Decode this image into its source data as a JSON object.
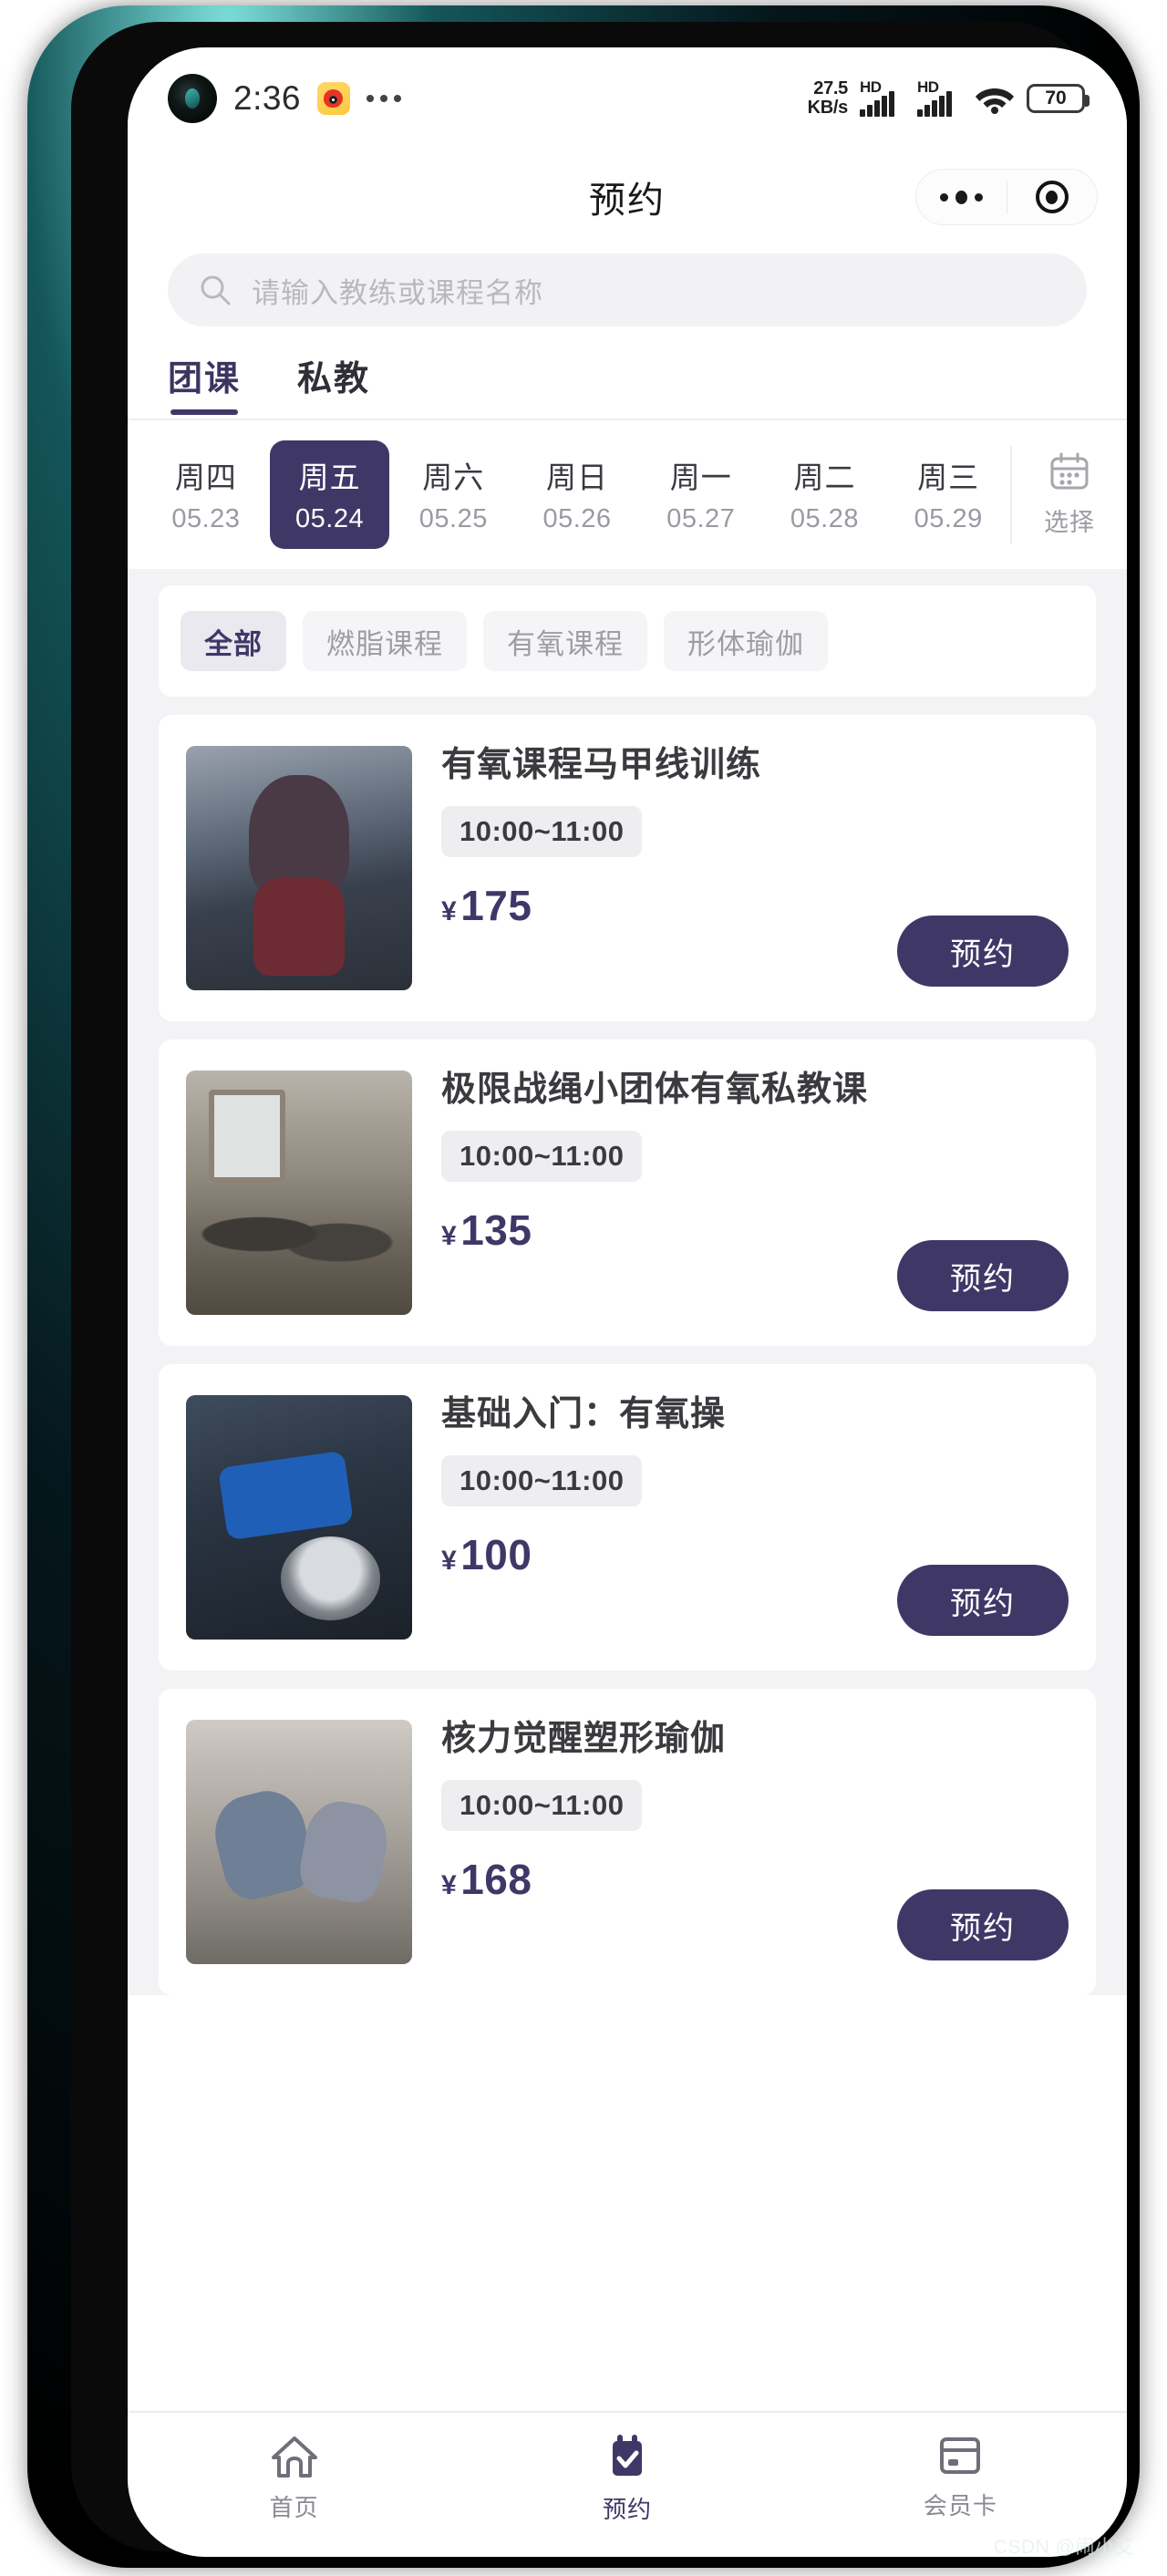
{
  "status_bar": {
    "time": "2:36",
    "notification_icon": "weibo-icon",
    "more_icon": "more-dots-icon",
    "network_speed": "27.5",
    "network_speed_unit": "KB/s",
    "sim1_label": "HD",
    "sim2_label": "HD",
    "wifi_icon": "wifi-icon",
    "battery_level": "70"
  },
  "header": {
    "title": "预约",
    "capsule_more_icon": "more-dots-icon",
    "capsule_target_icon": "target-circle-icon"
  },
  "search": {
    "icon": "search-icon",
    "placeholder": "请输入教练或课程名称",
    "value": ""
  },
  "tabs": [
    {
      "label": "团课",
      "active": true
    },
    {
      "label": "私教",
      "active": false
    }
  ],
  "dates": {
    "items": [
      {
        "dow": "周四",
        "date": "05.23",
        "selected": false
      },
      {
        "dow": "周五",
        "date": "05.24",
        "selected": true
      },
      {
        "dow": "周六",
        "date": "05.25",
        "selected": false
      },
      {
        "dow": "周日",
        "date": "05.26",
        "selected": false
      },
      {
        "dow": "周一",
        "date": "05.27",
        "selected": false
      },
      {
        "dow": "周二",
        "date": "05.28",
        "selected": false
      },
      {
        "dow": "周三",
        "date": "05.29",
        "selected": false
      }
    ],
    "picker": {
      "icon": "calendar-icon",
      "label": "选择"
    }
  },
  "filters": [
    {
      "label": "全部",
      "active": true
    },
    {
      "label": "燃脂课程",
      "active": false
    },
    {
      "label": "有氧课程",
      "active": false
    },
    {
      "label": "形体瑜伽",
      "active": false
    }
  ],
  "courses": [
    {
      "title": "有氧课程马甲线训练",
      "time": "10:00~11:00",
      "currency": "¥",
      "price": "175",
      "button": "预约",
      "thumb": "kettlebell-squat-photo"
    },
    {
      "title": "极限战绳小团体有氧私教课",
      "time": "10:00~11:00",
      "currency": "¥",
      "price": "135",
      "button": "预约",
      "thumb": "battle-ropes-photo"
    },
    {
      "title": "基础入门：有氧操",
      "time": "10:00~11:00",
      "currency": "¥",
      "price": "100",
      "button": "预约",
      "thumb": "stability-ball-plank-photo"
    },
    {
      "title": "核力觉醒塑形瑜伽",
      "time": "10:00~11:00",
      "currency": "¥",
      "price": "168",
      "button": "预约",
      "thumb": "yoga-class-photo"
    }
  ],
  "bottom_nav": [
    {
      "label": "首页",
      "icon": "home-icon",
      "active": false
    },
    {
      "label": "预约",
      "icon": "calendar-check-icon",
      "active": true
    },
    {
      "label": "会员卡",
      "icon": "membership-card-icon",
      "active": false
    }
  ],
  "watermark": "CSDN @闹小艾",
  "colors": {
    "accent": "#3f3867",
    "page_bg": "#f3f3f5",
    "chip_bg": "#f5f5f7",
    "muted_text": "#9a9aa4"
  }
}
